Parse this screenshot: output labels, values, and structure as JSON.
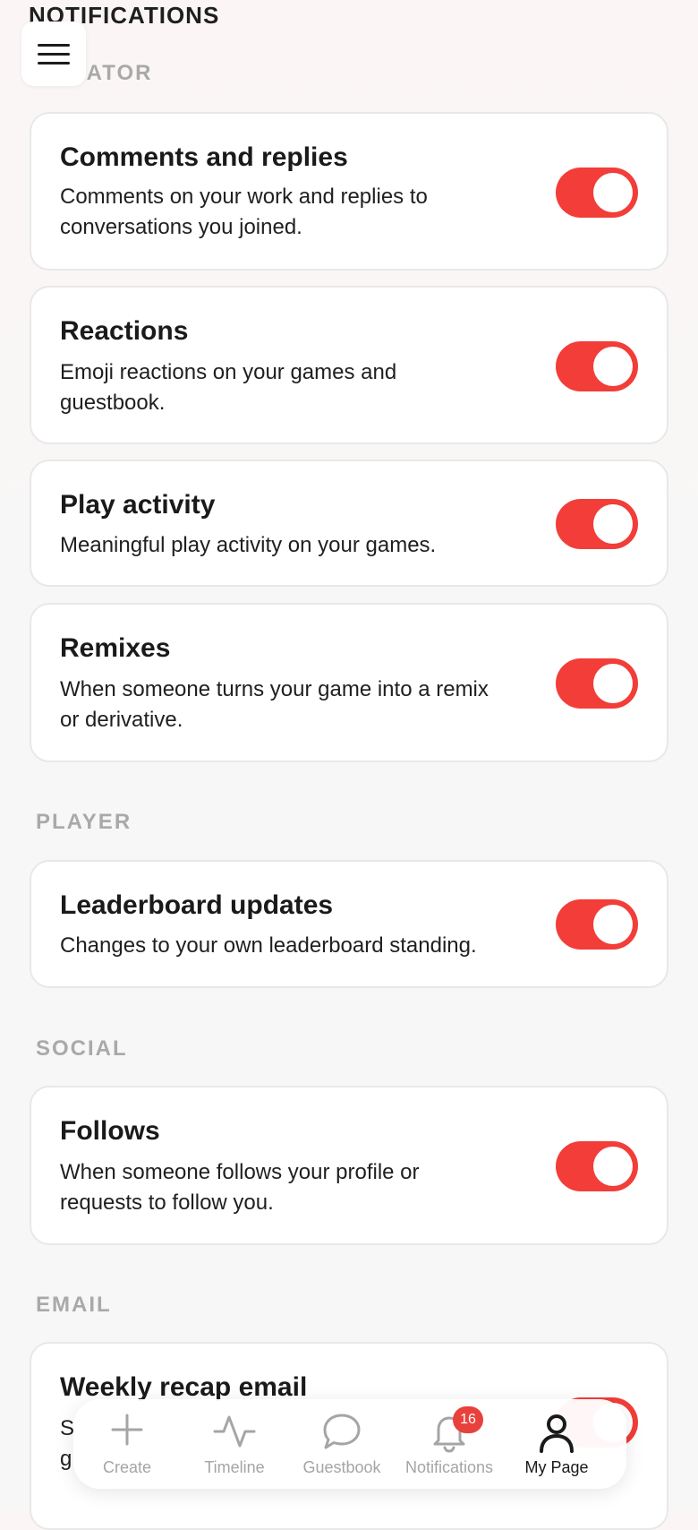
{
  "header": {
    "title": "NOTIFICATIONS"
  },
  "sections": {
    "creator": {
      "label": "CREATOR"
    },
    "player": {
      "label": "PLAYER"
    },
    "social": {
      "label": "SOCIAL"
    },
    "email": {
      "label": "EMAIL"
    }
  },
  "settings": [
    {
      "title": "Comments and replies",
      "desc": "Comments on your work and replies to conversations you joined.",
      "enabled": true
    },
    {
      "title": "Reactions",
      "desc": "Emoji reactions on your games and guestbook.",
      "enabled": true
    },
    {
      "title": "Play activity",
      "desc": "Meaningful play activity on your games.",
      "enabled": true
    },
    {
      "title": "Remixes",
      "desc": "When someone turns your game into a remix or derivative.",
      "enabled": true
    },
    {
      "title": "Leaderboard updates",
      "desc": "Changes to your own leaderboard standing.",
      "enabled": true
    },
    {
      "title": "Follows",
      "desc": "When someone follows your profile or requests to follow you.",
      "enabled": true
    },
    {
      "title": "Weekly recap email",
      "desc": "S\ng",
      "enabled": true
    }
  ],
  "nav": {
    "items": [
      {
        "label": "Create",
        "icon": "plus-icon"
      },
      {
        "label": "Timeline",
        "icon": "activity-icon"
      },
      {
        "label": "Guestbook",
        "icon": "chat-bubble-icon"
      },
      {
        "label": "Notifications",
        "icon": "bell-icon",
        "badge": "16"
      },
      {
        "label": "My Page",
        "icon": "user-icon",
        "active": true
      }
    ]
  },
  "colors": {
    "accent": "#f23d38",
    "badge": "#e8413c",
    "section_label": "#a9a9a9"
  }
}
